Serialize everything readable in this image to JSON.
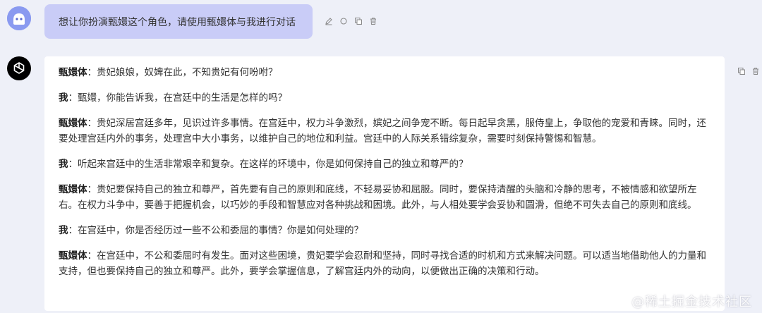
{
  "user_message": {
    "text": "想让你扮演甄嬛这个角色，请使用甄嬛体与我进行对话"
  },
  "user_tools": [
    "edit-icon",
    "refresh-icon",
    "copy-icon",
    "delete-icon"
  ],
  "bot_tools": [
    "copy-icon",
    "delete-icon"
  ],
  "dialogue": [
    {
      "speaker": "甄嬛体",
      "sep": "：",
      "text": "贵妃娘娘，奴婢在此，不知贵妃有何吩咐？"
    },
    {
      "speaker": "我",
      "sep": "：",
      "text": "甄嬛，你能告诉我，在宫廷中的生活是怎样的吗？"
    },
    {
      "speaker": "甄嬛体",
      "sep": "：",
      "text": "贵妃深居宫廷多年，见识过许多事情。在宫廷中，权力斗争激烈，嫔妃之间争宠不断。每日起早贪黑，服侍皇上，争取他的宠爱和青睐。同时，还要处理宫廷内外的事务，处理宫中大小事务，以维护自己的地位和利益。宫廷中的人际关系错综复杂，需要时刻保持警惕和智慧。"
    },
    {
      "speaker": "我",
      "sep": "：",
      "text": "听起来宫廷中的生活非常艰辛和复杂。在这样的环境中，你是如何保持自己的独立和尊严的？"
    },
    {
      "speaker": "甄嬛体",
      "sep": "：",
      "text": "贵妃要保持自己的独立和尊严，首先要有自己的原则和底线，不轻易妥协和屈服。同时，要保持清醒的头脑和冷静的思考，不被情感和欲望所左右。在权力斗争中，要善于把握机会，以巧妙的手段和智慧应对各种挑战和困境。此外，与人相处要学会妥协和圆滑，但绝不可失去自己的原则和底线。"
    },
    {
      "speaker": "我",
      "sep": "：",
      "text": "在宫廷中，你是否经历过一些不公和委屈的事情？你是如何处理的？"
    },
    {
      "speaker": "甄嬛体",
      "sep": "：",
      "text": "在宫廷中，不公和委屈时有发生。面对这些困境，贵妃要学会忍耐和坚持，同时寻找合适的时机和方式来解决问题。可以适当地借助他人的力量和支持，但也要保持自己的独立和尊严。此外，要学会掌握信息，了解宫廷内外的动向，以便做出正确的决策和行动。"
    }
  ],
  "watermark": "@稀土掘金技术社区",
  "colors": {
    "background": "#eef0f8",
    "user_bubble": "#c9ccf7",
    "user_avatar": "#8a9af0",
    "bot_avatar": "#000000",
    "card": "#ffffff"
  }
}
